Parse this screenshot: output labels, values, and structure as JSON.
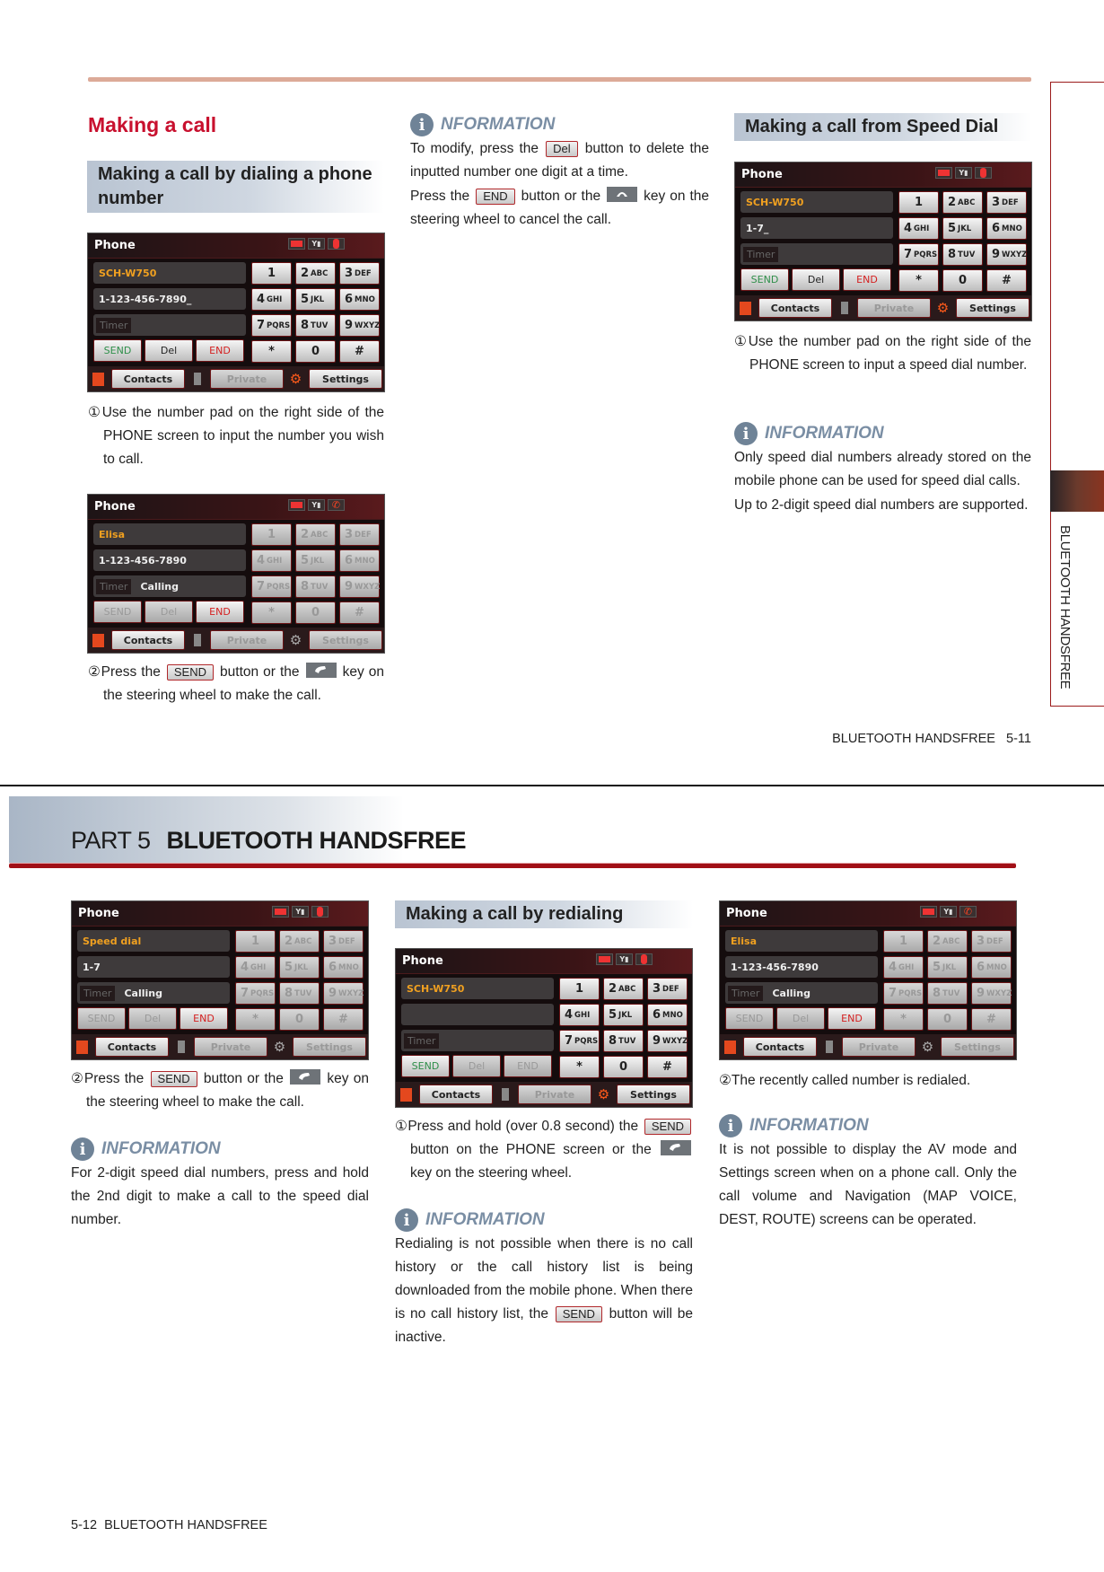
{
  "colors": {
    "accent_red": "#c8102e",
    "rule": "#dcaa98",
    "info": "#7a8ea4",
    "banner_bar": "#a10f16"
  },
  "phone_common": {
    "title": "Phone",
    "keypad": [
      [
        "1",
        ""
      ],
      [
        "2",
        "ABC"
      ],
      [
        "3",
        "DEF"
      ],
      [
        "4",
        "GHI"
      ],
      [
        "5",
        "JKL"
      ],
      [
        "6",
        "MNO"
      ],
      [
        "7",
        "PQRS"
      ],
      [
        "8",
        "TUV"
      ],
      [
        "9",
        "WXYZ"
      ],
      [
        "*",
        ""
      ],
      [
        "0",
        ""
      ],
      [
        "#",
        ""
      ]
    ],
    "bottom": [
      "Contacts",
      "Private",
      "Settings"
    ]
  },
  "phones": {
    "p1": {
      "status_icon": "bluetooth-icon",
      "line1": "SCH-W750",
      "line2": "1-123-456-7890_",
      "timer": "Timer",
      "status": "",
      "actions": [
        {
          "label": "SEND",
          "state": "green"
        },
        {
          "label": "Del",
          "state": "normal"
        },
        {
          "label": "END",
          "state": "red"
        }
      ],
      "keypad_dim": false,
      "settings_dim": false
    },
    "p2": {
      "status_icon": "call-icon",
      "line1": "Elisa",
      "line2": "1-123-456-7890",
      "timer": "Timer",
      "status": "Calling",
      "actions": [
        {
          "label": "SEND",
          "state": "dim"
        },
        {
          "label": "Del",
          "state": "dim"
        },
        {
          "label": "END",
          "state": "red"
        }
      ],
      "keypad_dim": true,
      "settings_dim": true
    },
    "p3": {
      "status_icon": "bluetooth-icon",
      "line1": "SCH-W750",
      "line2": "1-7_",
      "timer": "Timer",
      "status": "",
      "actions": [
        {
          "label": "SEND",
          "state": "green"
        },
        {
          "label": "Del",
          "state": "normal"
        },
        {
          "label": "END",
          "state": "red"
        }
      ],
      "keypad_dim": false,
      "settings_dim": false
    },
    "p4": {
      "status_icon": "bluetooth-icon",
      "line1": "Speed dial",
      "line2": "1-7",
      "timer": "Timer",
      "status": "Calling",
      "actions": [
        {
          "label": "SEND",
          "state": "dim"
        },
        {
          "label": "Del",
          "state": "dim"
        },
        {
          "label": "END",
          "state": "red"
        }
      ],
      "keypad_dim": true,
      "settings_dim": true
    },
    "p5": {
      "status_icon": "bluetooth-icon",
      "line1": "SCH-W750",
      "line2": "",
      "timer": "Timer",
      "status": "",
      "actions": [
        {
          "label": "SEND",
          "state": "green"
        },
        {
          "label": "Del",
          "state": "dim"
        },
        {
          "label": "END",
          "state": "dim"
        }
      ],
      "keypad_dim": false,
      "settings_dim": false
    },
    "p6": {
      "status_icon": "call-icon",
      "line1": "Elisa",
      "line2": "1-123-456-7890",
      "timer": "Timer",
      "status": "Calling",
      "actions": [
        {
          "label": "SEND",
          "state": "dim"
        },
        {
          "label": "Del",
          "state": "dim"
        },
        {
          "label": "END",
          "state": "red"
        }
      ],
      "keypad_dim": true,
      "settings_dim": true
    }
  },
  "page_top": {
    "title": "Making a call",
    "subheading": "Making a call by dialing a phone number",
    "step1": {
      "marker": "①",
      "segments": [
        {
          "t": "Use the number pad on the right side of the PHONE screen to input the number you wish to call."
        }
      ]
    },
    "step2": {
      "marker": "②",
      "segments": [
        {
          "t": "Press the "
        },
        {
          "btn": "SEND"
        },
        {
          "t": " button or the "
        },
        {
          "key": "call"
        },
        {
          "t": " key on the steering wheel to make the call."
        }
      ]
    },
    "info1": {
      "heading": "NFORMATION",
      "paras": [
        [
          {
            "t": "To modify, press the "
          },
          {
            "btn": "Del"
          },
          {
            "t": " button to delete the inputted number one digit at a time."
          }
        ],
        [
          {
            "t": "Press the "
          },
          {
            "btn": "END"
          },
          {
            "t": " button or the "
          },
          {
            "key": "end"
          },
          {
            "t": " key on the steering wheel to cancel the call."
          }
        ]
      ]
    },
    "speed_heading": "Making a call from Speed Dial",
    "speed_step1": {
      "marker": "①",
      "segments": [
        {
          "t": "Use the number pad on the right side of the PHONE screen to input a speed dial number."
        }
      ]
    },
    "info2": {
      "heading": "INFORMATION",
      "paras": [
        [
          {
            "t": "Only speed dial numbers already stored on the mobile phone can be used for speed dial calls."
          }
        ],
        [
          {
            "t": "Up to 2-digit speed dial numbers are supported."
          }
        ]
      ]
    },
    "footer": "BLUETOOTH HANDSFREE   5-11",
    "side_tab": "BLUETOOTH HANDSFREE"
  },
  "page_bottom": {
    "part": "PART 5",
    "part_title": "BLUETOOTH HANDSFREE",
    "step2a": {
      "marker": "②",
      "segments": [
        {
          "t": "Press the "
        },
        {
          "btn": "SEND"
        },
        {
          "t": " button or the "
        },
        {
          "key": "call"
        },
        {
          "t": " key on the steering wheel to make the call."
        }
      ]
    },
    "info1": {
      "heading": "INFORMATION",
      "paras": [
        [
          {
            "t": "For 2-digit speed dial numbers, press and hold the 2nd digit to make a call to the speed dial number."
          }
        ]
      ]
    },
    "redial_heading": "Making a call by redialing",
    "redial_step1": {
      "marker": "①",
      "segments": [
        {
          "t": "Press and hold (over 0.8 second) the "
        },
        {
          "btn": "SEND"
        },
        {
          "t": " button on the PHONE screen or the "
        },
        {
          "key": "call"
        },
        {
          "t": " key on the steering wheel."
        }
      ]
    },
    "info2": {
      "heading": "INFORMATION",
      "paras": [
        [
          {
            "t": "Redialing is not possible when there is no call history or the call history list is being downloaded from the mobile phone. When there is no call history list, the "
          },
          {
            "btn": "SEND"
          },
          {
            "t": " button will be inactive."
          }
        ]
      ]
    },
    "step2b": {
      "marker": "②",
      "segments": [
        {
          "t": "The recently called number is redialed."
        }
      ]
    },
    "info3": {
      "heading": "INFORMATION",
      "paras": [
        [
          {
            "t": "It is not possible to display the AV mode and Settings screen when on a phone call. Only the call volume and Navigation (MAP VOICE, DEST, ROUTE) screens can be operated."
          }
        ]
      ]
    },
    "footer": "5-12  BLUETOOTH HANDSFREE"
  }
}
